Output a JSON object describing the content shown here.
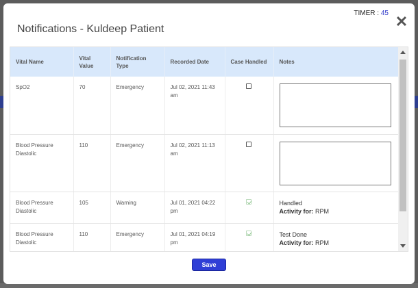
{
  "modal": {
    "title": "Notifications - Kuldeep Patient",
    "timer_label": "TIMER :",
    "timer_value": "45",
    "close_glyph": "✕"
  },
  "table": {
    "headers": [
      "Vital Name",
      "Vital Value",
      "Notification Type",
      "Recorded Date",
      "Case Handled",
      "Notes"
    ],
    "rows": [
      {
        "vital_name": "SpO2",
        "vital_value": "70",
        "type": "Emergency",
        "recorded": "Jul 02, 2021 11:43 am",
        "handled": false,
        "notes": ""
      },
      {
        "vital_name": "Blood Pressure Diastolic",
        "vital_value": "110",
        "type": "Emergency",
        "recorded": "Jul 02, 2021 11:13 am",
        "handled": false,
        "notes": ""
      },
      {
        "vital_name": "Blood Pressure Diastolic",
        "vital_value": "105",
        "type": "Warning",
        "recorded": "Jul 01, 2021 04:22 pm",
        "handled": true,
        "notes": "Handled",
        "activity_label": "Activity for:",
        "activity_value": "RPM"
      },
      {
        "vital_name": "Blood Pressure Diastolic",
        "vital_value": "110",
        "type": "Emergency",
        "recorded": "Jul 01, 2021 04:19 pm",
        "handled": true,
        "notes": "Test Done",
        "activity_label": "Activity for:",
        "activity_value": "RPM"
      }
    ]
  },
  "footer": {
    "save_label": "Save"
  },
  "colors": {
    "header_bg": "#d8e8fb",
    "save_bg": "#2f3fd6",
    "timer_value": "#2a35c8"
  }
}
